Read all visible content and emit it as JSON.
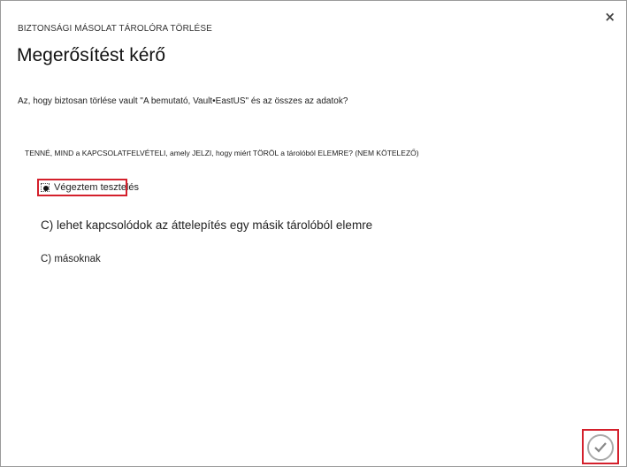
{
  "dialog": {
    "subtitle": "BIZTONSÁGI MÁSOLAT TÁROLÓRA TÖRLÉSE",
    "title": "Megerősítést kérő",
    "close_symbol": "×",
    "question": "Az, hogy biztosan törlése vault \"A bemutató, Vault•EastUS\" és az összes az adatok?",
    "reason_label": "TENNÉ, MIND a KAPCSOLATFELVÉTELI, amely JELZI, hogy miért TÖRÖL a tárolóból ELEMRE? (NEM KÖTELEZŐ)",
    "options": [
      {
        "label": "Végeztem tesztelés",
        "selected": true
      },
      {
        "label": "C) lehet kapcsolódok az áttelepítés egy másik tárolóból elemre",
        "selected": false
      },
      {
        "label": "C) másoknak",
        "selected": false
      }
    ],
    "confirm_icon": "checkmark-icon"
  },
  "colors": {
    "highlight": "#d4202c",
    "border": "#9a9a9a"
  }
}
